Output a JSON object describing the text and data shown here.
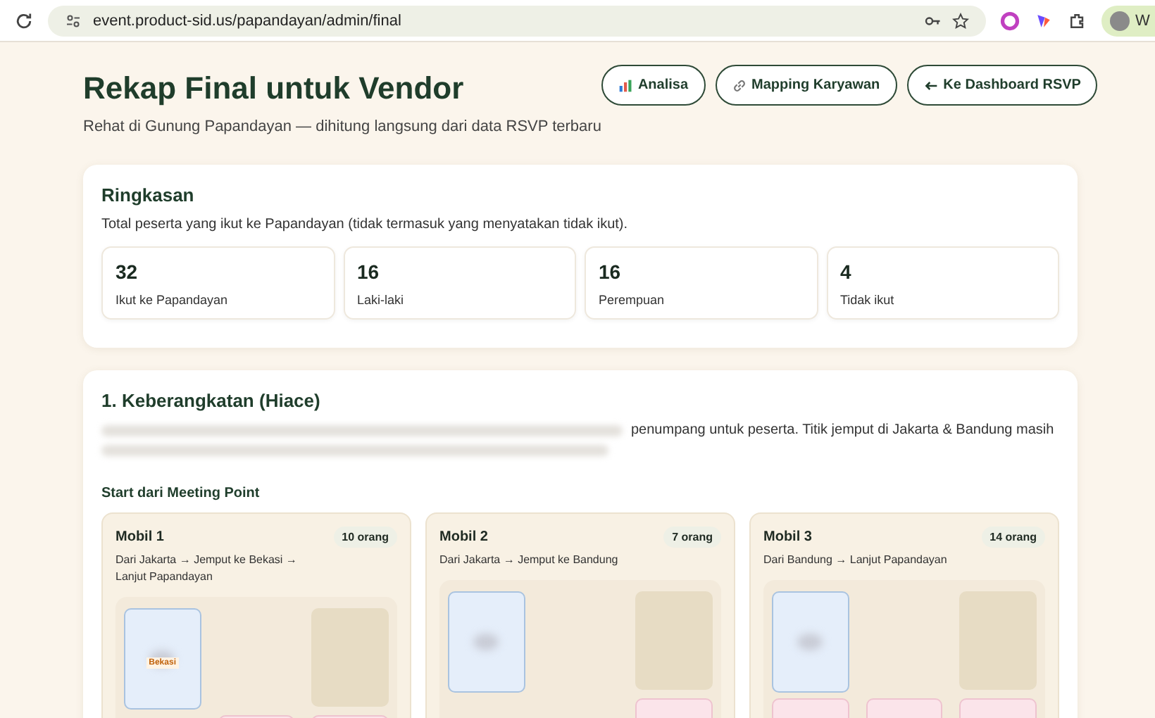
{
  "browser": {
    "url": "event.product-sid.us/papandayan/admin/final",
    "profile_initial": "W"
  },
  "header": {
    "title": "Rekap Final untuk Vendor",
    "subtitle": "Rehat di Gunung Papandayan — dihitung langsung dari data RSVP terbaru",
    "buttons": [
      {
        "kind": "chart",
        "label": "Analisa"
      },
      {
        "kind": "link",
        "label": "Mapping Karyawan"
      },
      {
        "kind": "back",
        "label": "Ke Dashboard RSVP"
      }
    ]
  },
  "summary": {
    "title": "Ringkasan",
    "description": "Total peserta yang ikut ke Papandayan (tidak termasuk yang menyatakan tidak ikut).",
    "stats": [
      {
        "value": "32",
        "label": "Ikut ke Papandayan"
      },
      {
        "value": "16",
        "label": "Laki-laki"
      },
      {
        "value": "16",
        "label": "Perempuan"
      },
      {
        "value": "4",
        "label": "Tidak ikut"
      }
    ]
  },
  "departure": {
    "title": "1. Keberangkatan (Hiace)",
    "description_visible": "penumpang untuk peserta. Titik jemput di Jakarta & Bandung masih",
    "subheading": "Start dari Meeting Point",
    "cars": [
      {
        "name": "Mobil 1",
        "count": "10 orang",
        "route": "Dari Jakarta → Jemput ke Bekasi → Lanjut Papandayan",
        "seats": [
          {
            "kind": "male",
            "tag": "Bekasi"
          },
          {
            "kind": "empty"
          },
          {
            "kind": "driver"
          },
          {
            "kind": "empty"
          },
          {
            "kind": "female"
          },
          {
            "kind": "female"
          }
        ]
      },
      {
        "name": "Mobil 2",
        "count": "7 orang",
        "route": "Dari Jakarta → Jemput ke Bandung",
        "seats": [
          {
            "kind": "male"
          },
          {
            "kind": "empty"
          },
          {
            "kind": "driver"
          },
          {
            "kind": "empty"
          },
          {
            "kind": "empty"
          },
          {
            "kind": "female"
          }
        ]
      },
      {
        "name": "Mobil 3",
        "count": "14 orang",
        "route": "Dari Bandung → Lanjut Papandayan",
        "seats": [
          {
            "kind": "male"
          },
          {
            "kind": "empty"
          },
          {
            "kind": "driver"
          },
          {
            "kind": "female"
          },
          {
            "kind": "female"
          },
          {
            "kind": "female"
          }
        ]
      }
    ]
  }
}
